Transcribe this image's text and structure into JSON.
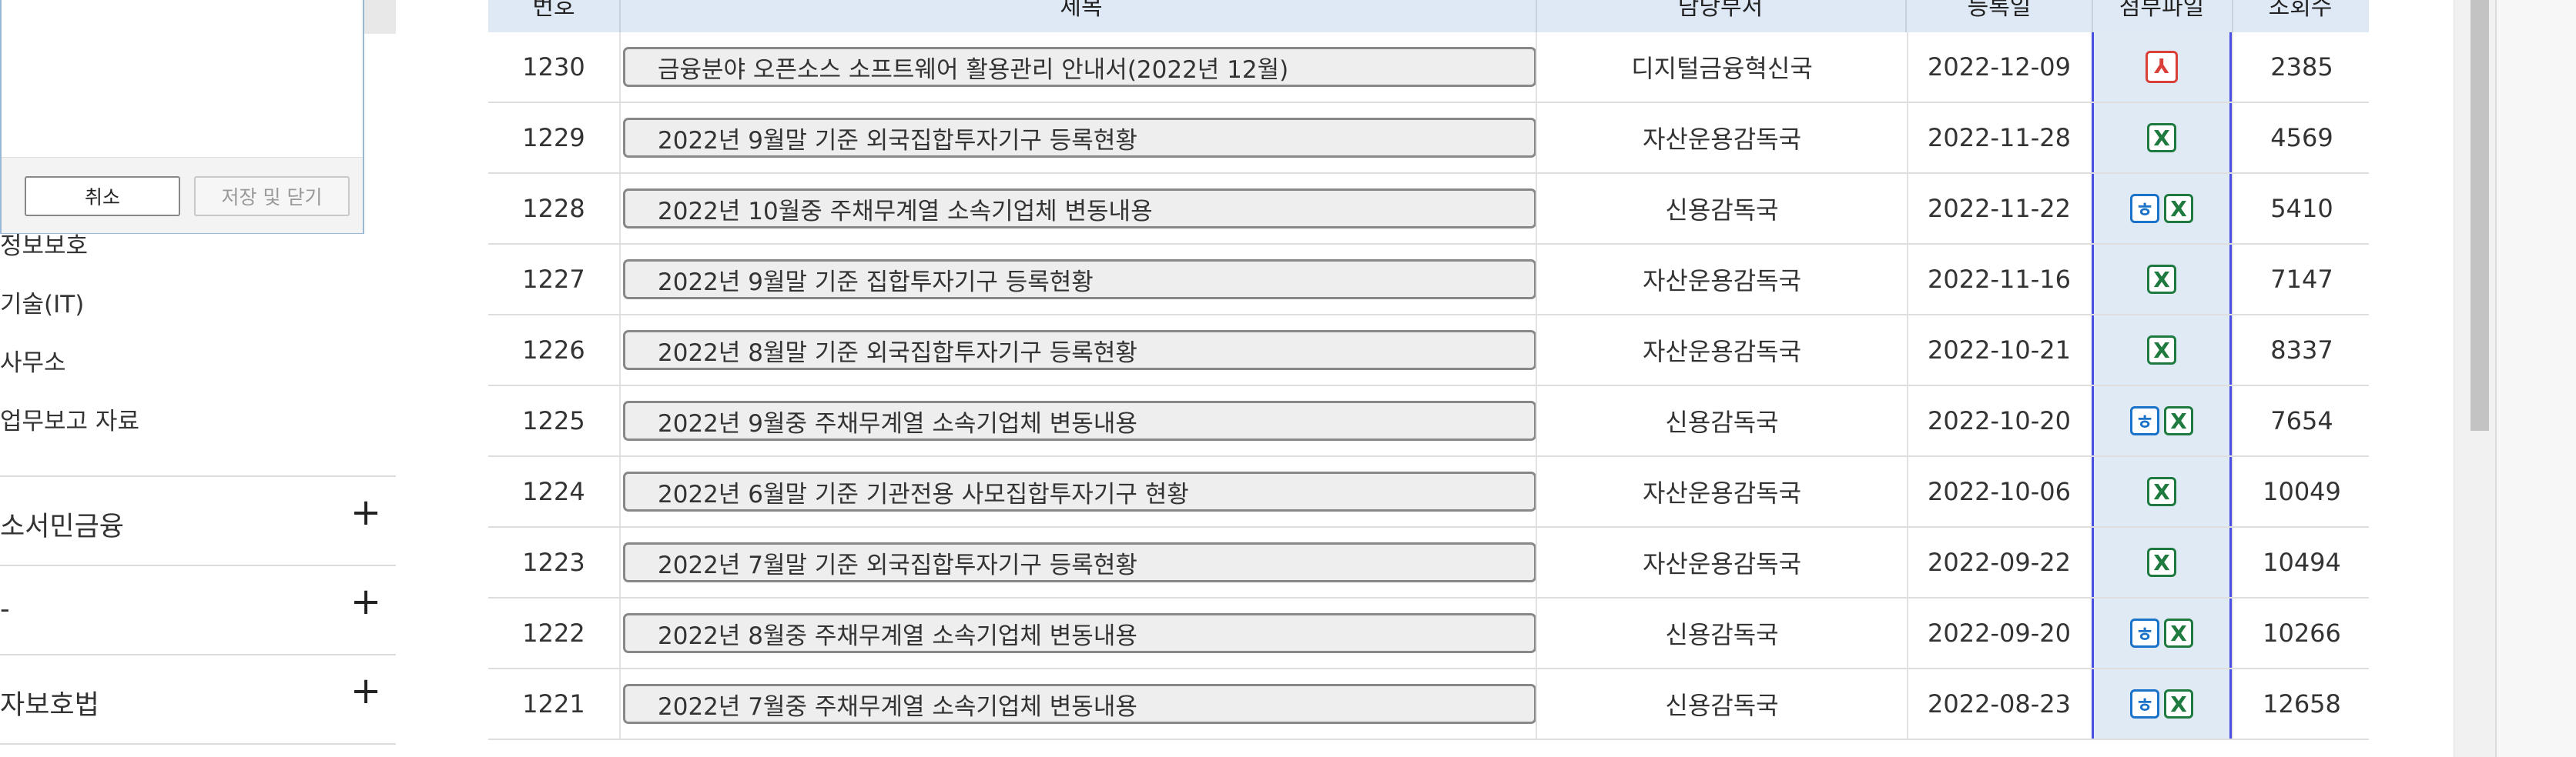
{
  "dialog": {
    "cancel_label": "취소",
    "save_label": "저장 및 닫기"
  },
  "sidebar": {
    "sub_items": [
      {
        "label": "정보보호"
      },
      {
        "label": "기술(IT)"
      },
      {
        "label": "사무소"
      },
      {
        "label": "업무보고 자료"
      }
    ],
    "accordion": [
      {
        "label": "소서민금융",
        "toggle": "+"
      },
      {
        "label": "-",
        "toggle": "+"
      },
      {
        "label": "자보호법",
        "toggle": "+"
      }
    ]
  },
  "table": {
    "headers": [
      "번호",
      "제목",
      "담당부서",
      "등록일",
      "첨부파일",
      "조회수"
    ],
    "rows": [
      {
        "no": "1230",
        "title": "금융분야 오픈소스 소프트웨어 활용관리 안내서(2022년 12월)",
        "dept": "디지털금융혁신국",
        "date": "2022-12-09",
        "files": [
          "pdf"
        ],
        "views": "2385"
      },
      {
        "no": "1229",
        "title": "2022년 9월말 기준 외국집합투자기구 등록현황",
        "dept": "자산운용감독국",
        "date": "2022-11-28",
        "files": [
          "xls"
        ],
        "views": "4569"
      },
      {
        "no": "1228",
        "title": "2022년 10월중 주채무계열 소속기업체 변동내용",
        "dept": "신용감독국",
        "date": "2022-11-22",
        "files": [
          "hwp",
          "xls"
        ],
        "views": "5410"
      },
      {
        "no": "1227",
        "title": "2022년 9월말 기준 집합투자기구 등록현황",
        "dept": "자산운용감독국",
        "date": "2022-11-16",
        "files": [
          "xls"
        ],
        "views": "7147"
      },
      {
        "no": "1226",
        "title": "2022년 8월말 기준 외국집합투자기구 등록현황",
        "dept": "자산운용감독국",
        "date": "2022-10-21",
        "files": [
          "xls"
        ],
        "views": "8337"
      },
      {
        "no": "1225",
        "title": "2022년 9월중 주채무계열 소속기업체 변동내용",
        "dept": "신용감독국",
        "date": "2022-10-20",
        "files": [
          "hwp",
          "xls"
        ],
        "views": "7654"
      },
      {
        "no": "1224",
        "title": "2022년 6월말 기준 기관전용 사모집합투자기구 현황",
        "dept": "자산운용감독국",
        "date": "2022-10-06",
        "files": [
          "xls"
        ],
        "views": "10049"
      },
      {
        "no": "1223",
        "title": "2022년 7월말 기준 외국집합투자기구 등록현황",
        "dept": "자산운용감독국",
        "date": "2022-09-22",
        "files": [
          "xls"
        ],
        "views": "10494"
      },
      {
        "no": "1222",
        "title": "2022년 8월중 주채무계열 소속기업체 변동내용",
        "dept": "신용감독국",
        "date": "2022-09-20",
        "files": [
          "hwp",
          "xls"
        ],
        "views": "10266"
      },
      {
        "no": "1221",
        "title": "2022년 7월중 주채무계열 소속기업체 변동내용",
        "dept": "신용감독국",
        "date": "2022-08-23",
        "files": [
          "hwp",
          "xls"
        ],
        "views": "12658"
      }
    ]
  },
  "icons": {
    "pdf": {
      "name": "pdf-file-icon",
      "glyph": "⅄",
      "color": "#d9403a"
    },
    "xls": {
      "name": "excel-file-icon",
      "glyph": "X",
      "color": "#1f7a3f"
    },
    "hwp": {
      "name": "hwp-file-icon",
      "glyph": "ㅎ",
      "color": "#1a73c9"
    }
  }
}
